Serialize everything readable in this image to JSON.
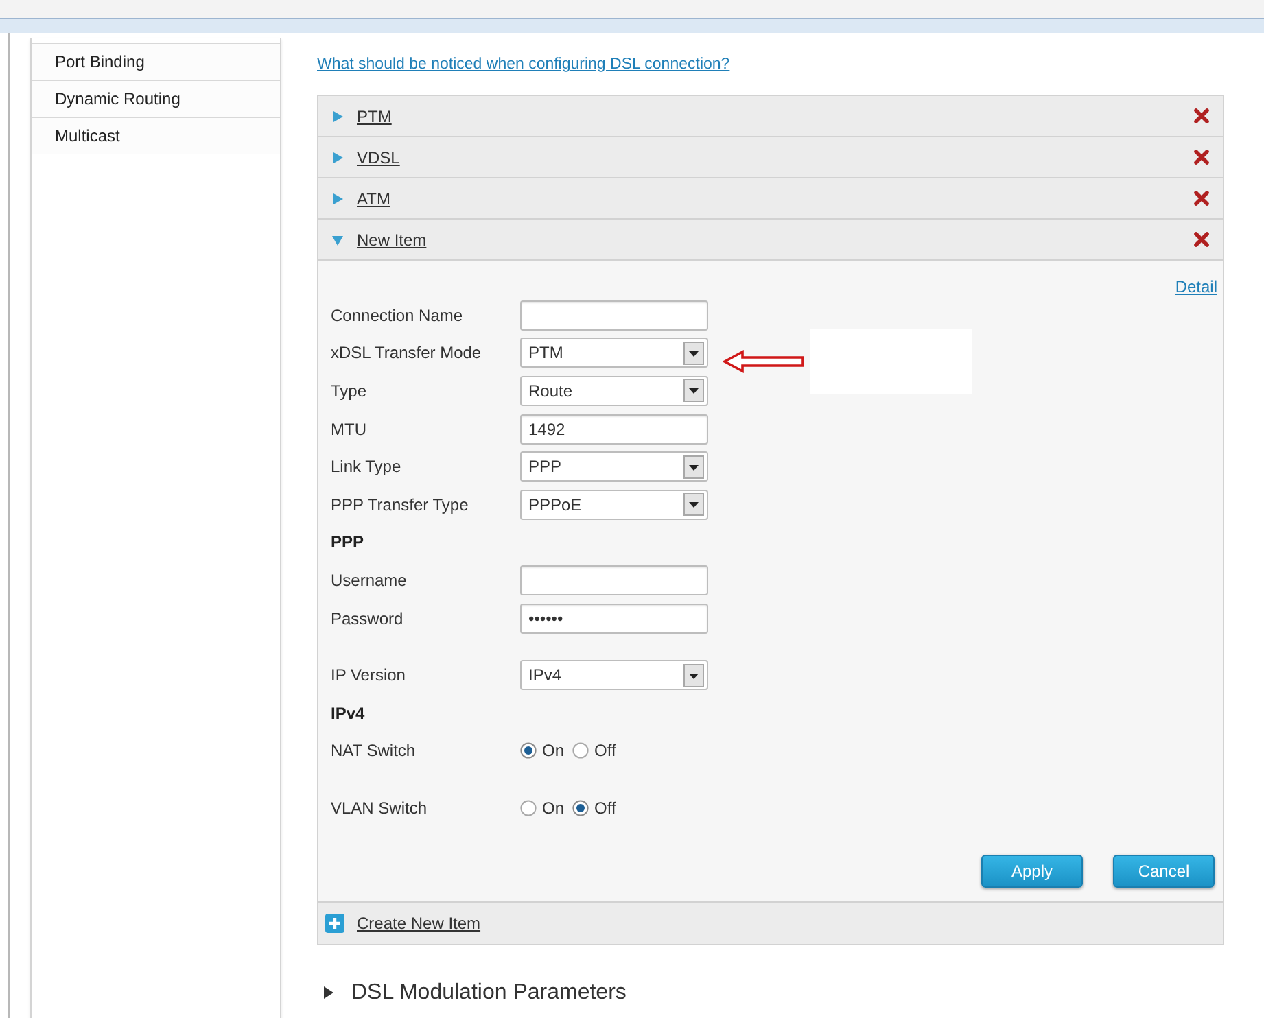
{
  "sidebar": {
    "items": [
      {
        "label": "Port Binding",
        "selected": false
      },
      {
        "label": "Dynamic Routing",
        "selected": false
      },
      {
        "label": "Multicast",
        "selected": false
      }
    ]
  },
  "help_link": "What should be noticed when configuring DSL connection?",
  "connections": [
    {
      "label": "PTM",
      "expanded": false
    },
    {
      "label": "VDSL",
      "expanded": false
    },
    {
      "label": "ATM",
      "expanded": false
    },
    {
      "label": "New Item",
      "expanded": true
    }
  ],
  "form": {
    "detail_link": "Detail",
    "groups": [
      {
        "rows": [
          {
            "kind": "text",
            "label": "Connection Name"
          },
          {
            "kind": "select",
            "label": "xDSL Transfer Mode",
            "value": "PTM"
          },
          {
            "kind": "select",
            "label": "Type",
            "value": "Route"
          },
          {
            "kind": "text",
            "label": "MTU",
            "value": "1492"
          },
          {
            "kind": "select",
            "label": "Link Type",
            "value": "PPP"
          },
          {
            "kind": "select",
            "label": "PPP Transfer Type",
            "value": "PPPoE"
          },
          {
            "kind": "heading",
            "label": "PPP"
          },
          {
            "kind": "text",
            "label": "Username"
          },
          {
            "kind": "text",
            "label": "Password",
            "value": "••••••"
          }
        ]
      },
      {
        "rows": [
          {
            "kind": "select",
            "label": "IP Version",
            "value": "IPv4"
          },
          {
            "kind": "heading",
            "label": "IPv4"
          },
          {
            "kind": "radio",
            "label": "NAT Switch",
            "options": [
              {
                "label": "On",
                "selected": true
              },
              {
                "label": "Off",
                "selected": false
              }
            ]
          }
        ]
      },
      {
        "rows": [
          {
            "kind": "radio",
            "label": "VLAN Switch",
            "options": [
              {
                "label": "On",
                "selected": false
              },
              {
                "label": "Off",
                "selected": true
              }
            ]
          }
        ]
      }
    ],
    "buttons": [
      "Apply",
      "Cancel"
    ]
  },
  "create_link": "Create New Item",
  "section": {
    "label": "DSL Modulation Parameters",
    "expanded": false
  }
}
